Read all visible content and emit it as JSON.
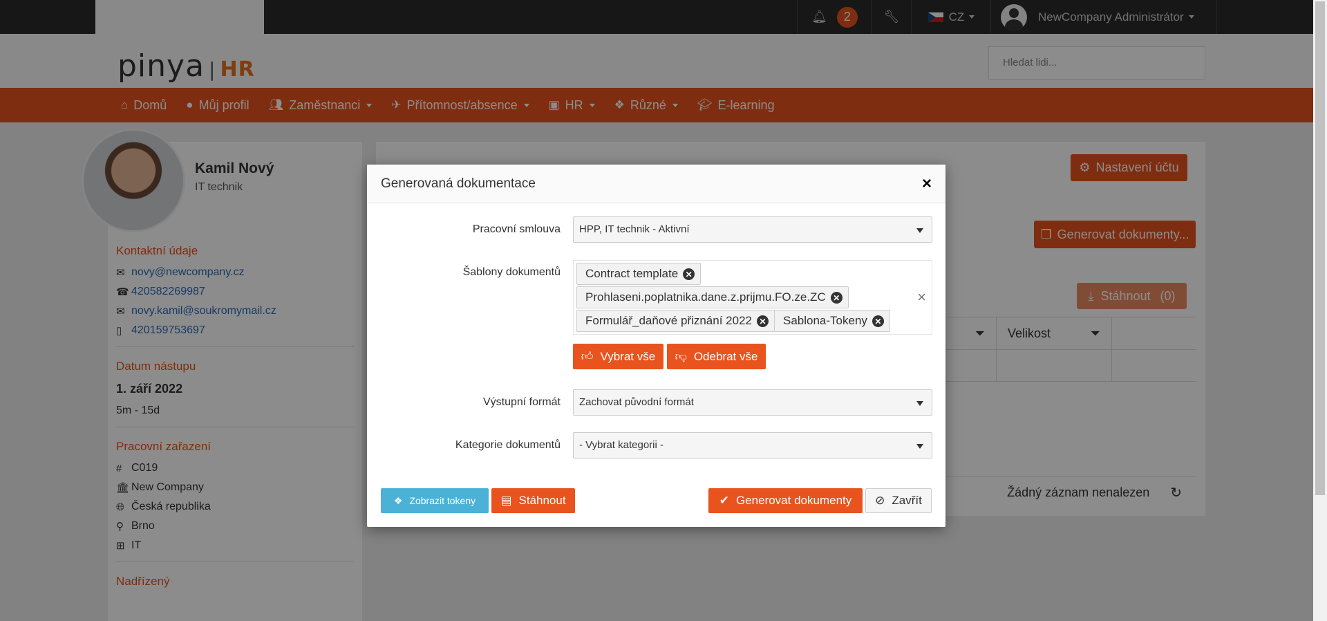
{
  "topbar": {
    "notifications_count": "2",
    "language": "CZ",
    "user_name": "NewCompany Administrátor"
  },
  "brand": {
    "name": "pinya",
    "suffix": "HR"
  },
  "search": {
    "placeholder": "Hledat lidi..."
  },
  "nav": {
    "items": [
      {
        "label": "Domů",
        "icon": "home-icon"
      },
      {
        "label": "Můj profil",
        "icon": "user-icon"
      },
      {
        "label": "Zaměstnanci",
        "icon": "users-icon"
      },
      {
        "label": "Přítomnost/absence",
        "icon": "plane-icon"
      },
      {
        "label": "HR",
        "icon": "id-card-icon"
      },
      {
        "label": "Různé",
        "icon": "cubes-icon"
      },
      {
        "label": "E-learning",
        "icon": "graduation-cap-icon"
      }
    ]
  },
  "profile": {
    "name": "Kamil Nový",
    "role": "IT technik",
    "contact_title": "Kontaktní údaje",
    "email": "novy@newcompany.cz",
    "phone": "420582269987",
    "email2": "novy.kamil@soukromymail.cz",
    "mobile": "420159753697",
    "start_title": "Datum nástupu",
    "start_date": "1. září 2022",
    "tenure": "5m - 15d",
    "position_title": "Pracovní zařazení",
    "code": "C019",
    "company": "New Company",
    "country": "Česká republika",
    "city": "Brno",
    "department": "IT",
    "supervisor_title": "Nadřízený"
  },
  "main": {
    "account_settings": "Nastavení účtu",
    "generate_docs": "Generovat dokumenty...",
    "download": "Stáhnout",
    "download_count": "(0)",
    "column_size": "Velikost",
    "no_records": "Žádný záznam nenalezen"
  },
  "modal": {
    "title": "Generovaná dokumentace",
    "contract_label": "Pracovní smlouva",
    "contract_value": "HPP, IT technik - Aktivní",
    "templates_label": "Šablony dokumentů",
    "templates": [
      "Contract template",
      "Prohlaseni.poplatnika.dane.z.prijmu.FO.ze.ZC",
      "Formulář_daňové přiznání 2022",
      "Sablona-Tokeny"
    ],
    "select_all": "Vybrat vše",
    "remove_all": "Odebrat vše",
    "format_label": "Výstupní formát",
    "format_value": "Zachovat původní formát",
    "category_label": "Kategorie dokumentů",
    "category_value": "- Vybrat kategorii -",
    "show_tokens": "Zobrazit tokeny",
    "download": "Stáhnout",
    "generate": "Generovat dokumenty",
    "close": "Zavřít"
  },
  "colors": {
    "accent": "#e8531e",
    "info": "#4bb1d6"
  }
}
